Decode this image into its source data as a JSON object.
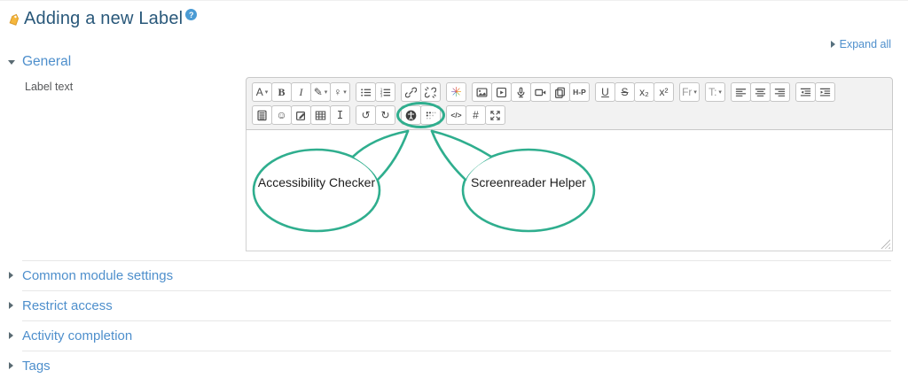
{
  "page": {
    "title": "Adding a new Label",
    "help_glyph": "?",
    "expand_all": "Expand all"
  },
  "general": {
    "heading": "General",
    "field_label": "Label text"
  },
  "callouts": [
    {
      "label": "Accessibility Checker"
    },
    {
      "label": "Screenreader Helper"
    }
  ],
  "sections": [
    {
      "label": "Common module settings"
    },
    {
      "label": "Restrict access"
    },
    {
      "label": "Activity completion"
    },
    {
      "label": "Tags"
    }
  ],
  "colors": {
    "accent_green": "#2FAE8E",
    "link_blue": "#4E8FCC",
    "heading_blue": "#29587A",
    "toolbar_bg": "#F2F2F2"
  },
  "editor": {
    "toolbar": {
      "rows": [
        {
          "groups": [
            {
              "buttons": [
                {
                  "name": "font-style",
                  "glyph": "A",
                  "dropdown": true
                },
                {
                  "name": "bold",
                  "glyph": "B",
                  "style": "serif-bold"
                },
                {
                  "name": "italic",
                  "glyph": "I",
                  "style": "serif-italic"
                },
                {
                  "name": "font-color",
                  "glyph": "✎",
                  "dropdown": true
                },
                {
                  "name": "background-color",
                  "glyph": "♀",
                  "dropdown": true
                }
              ]
            },
            {
              "buttons": [
                {
                  "name": "unordered-list",
                  "svg": "list-ul"
                },
                {
                  "name": "ordered-list",
                  "svg": "list-ol"
                }
              ]
            },
            {
              "buttons": [
                {
                  "name": "link",
                  "svg": "link"
                },
                {
                  "name": "unlink",
                  "svg": "unlink"
                }
              ]
            },
            {
              "buttons": [
                {
                  "name": "emoji-picker",
                  "glyph": "✳",
                  "style": "rainbow"
                }
              ]
            },
            {
              "buttons": [
                {
                  "name": "insert-image",
                  "svg": "image"
                },
                {
                  "name": "insert-media",
                  "svg": "media"
                },
                {
                  "name": "record-audio",
                  "svg": "mic"
                },
                {
                  "name": "record-video",
                  "svg": "video"
                },
                {
                  "name": "manage-files",
                  "svg": "files"
                },
                {
                  "name": "insert-h5p",
                  "glyph": "H-P",
                  "style": "tiny-bold"
                }
              ]
            },
            {
              "buttons": [
                {
                  "name": "underline",
                  "glyph": "U",
                  "style": "underline"
                },
                {
                  "name": "strikethrough",
                  "glyph": "S",
                  "style": "strike"
                },
                {
                  "name": "subscript",
                  "glyph": "x₂"
                },
                {
                  "name": "superscript",
                  "glyph": "x²"
                }
              ]
            },
            {
              "buttons": [
                {
                  "name": "font-family",
                  "glyph": "Fr",
                  "dropdown": true,
                  "muted": true
                }
              ]
            },
            {
              "buttons": [
                {
                  "name": "font-size",
                  "glyph": "T:",
                  "dropdown": true,
                  "muted": true
                }
              ]
            },
            {
              "buttons": [
                {
                  "name": "align-left",
                  "svg": "align-left"
                },
                {
                  "name": "align-center",
                  "svg": "align-center"
                },
                {
                  "name": "align-right",
                  "svg": "align-right"
                }
              ]
            },
            {
              "buttons": [
                {
                  "name": "outdent",
                  "svg": "outdent"
                },
                {
                  "name": "indent",
                  "svg": "indent"
                }
              ]
            }
          ]
        },
        {
          "groups": [
            {
              "buttons": [
                {
                  "name": "equation",
                  "svg": "calc"
                },
                {
                  "name": "emoticon",
                  "glyph": "☺"
                },
                {
                  "name": "chart",
                  "svg": "edit-square"
                },
                {
                  "name": "table",
                  "svg": "table"
                },
                {
                  "name": "clear-formatting",
                  "glyph": "I",
                  "style": "ibeam"
                }
              ]
            },
            {
              "buttons": [
                {
                  "name": "undo",
                  "glyph": "↺"
                },
                {
                  "name": "redo",
                  "glyph": "↻"
                }
              ]
            },
            {
              "highlight": true,
              "buttons": [
                {
                  "name": "accessibility-checker",
                  "svg": "a11y"
                },
                {
                  "name": "screenreader-helper",
                  "svg": "braille"
                }
              ]
            },
            {
              "buttons": [
                {
                  "name": "html",
                  "glyph": "</>",
                  "style": "tiny-bold"
                },
                {
                  "name": "insert-character",
                  "glyph": "#"
                },
                {
                  "name": "fullscreen",
                  "svg": "expand"
                }
              ]
            }
          ]
        }
      ]
    }
  }
}
